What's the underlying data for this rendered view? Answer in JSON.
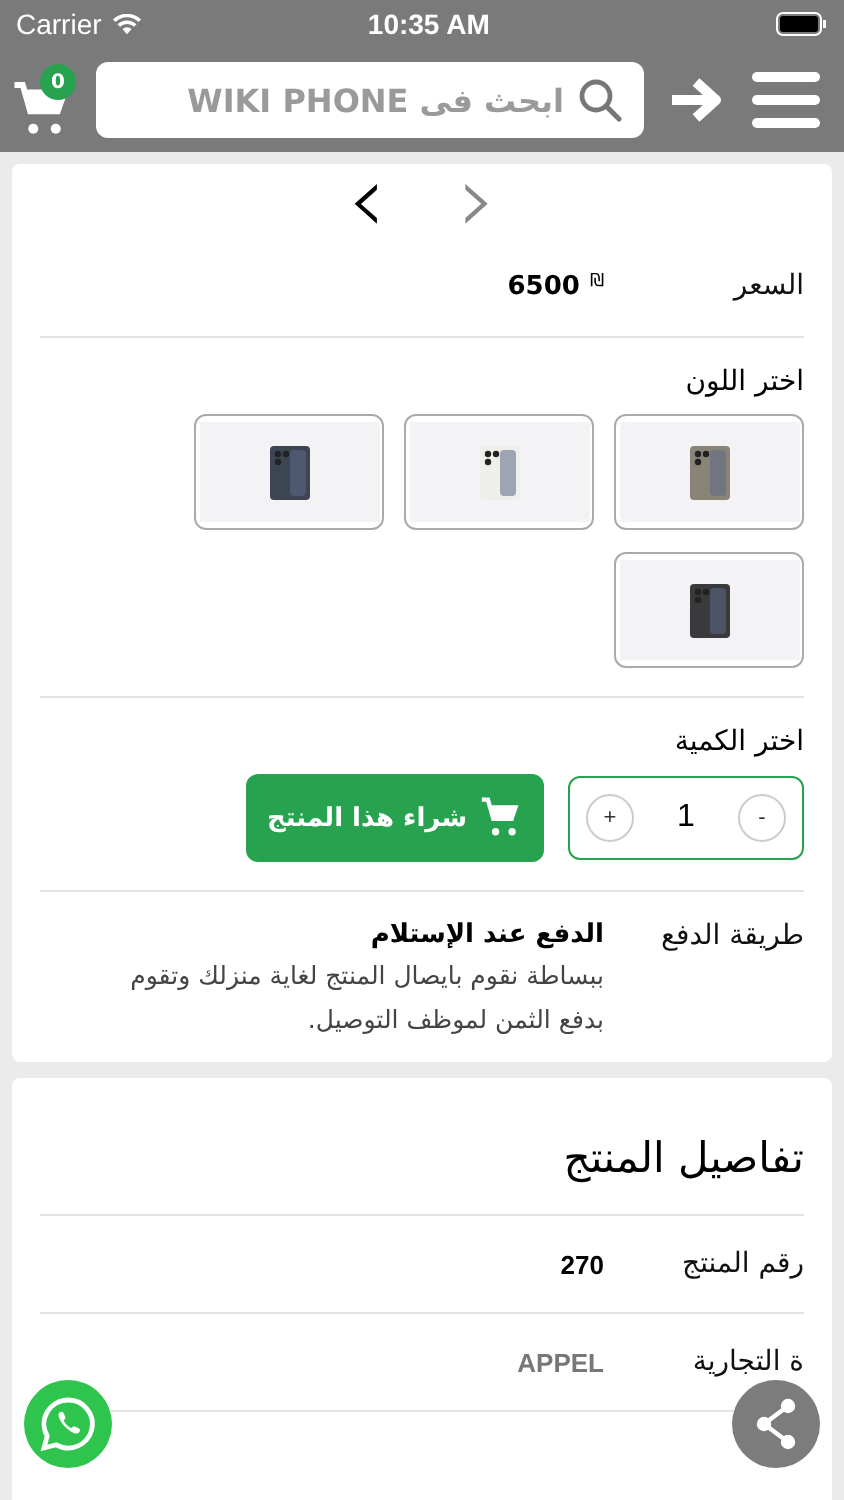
{
  "status_bar": {
    "carrier": "Carrier",
    "time": "10:35 AM"
  },
  "header": {
    "cart_count": "0",
    "search": {
      "placeholder": "ابحث فى WIKI PHONE"
    }
  },
  "gallery_nav": {
    "prev": "‹",
    "next": "›"
  },
  "price": {
    "label": "السعر",
    "currency": "₪",
    "value": "6500"
  },
  "colors": {
    "label": "اختر اللون",
    "options": [
      {
        "color": "#8a8478",
        "selected": false
      },
      {
        "color": "#eeeeea",
        "selected": false
      },
      {
        "color": "#3e4552",
        "selected": false
      },
      {
        "color": "#3a3a3c",
        "selected": false
      }
    ]
  },
  "quantity": {
    "label": "اختر الكمية",
    "minus": "-",
    "value": "1",
    "plus": "+"
  },
  "buy_button": "شراء هذا المنتج",
  "payment": {
    "label": "طريقة الدفع",
    "title": "الدفع عند الإستلام",
    "description": "ببساطة نقوم بايصال المنتج لغاية منزلك وتقوم بدفع الثمن لموظف التوصيل."
  },
  "details": {
    "title": "تفاصيل المنتج",
    "rows": [
      {
        "label": "رقم المنتج",
        "value": "270",
        "kind": "plain"
      },
      {
        "label": "ة التجارية",
        "value": "APPEL",
        "kind": "brand"
      }
    ]
  }
}
